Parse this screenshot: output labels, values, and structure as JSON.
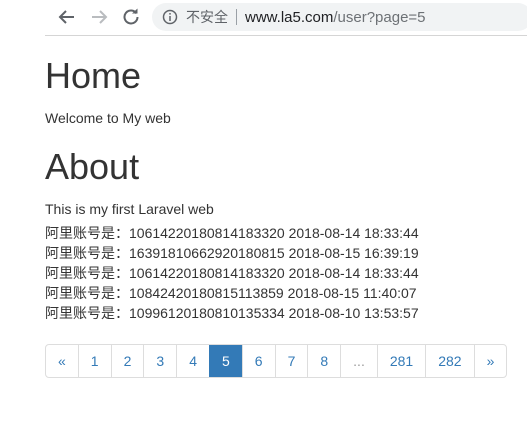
{
  "browser": {
    "security_label": "不安全",
    "url_host": "www.la5.com",
    "url_path": "/user?page=5",
    "icons": {
      "back": "back-arrow-icon",
      "forward": "forward-arrow-icon",
      "reload": "reload-icon",
      "info": "info-icon"
    }
  },
  "page": {
    "home_heading": "Home",
    "home_text": "Welcome to My web",
    "about_heading": "About",
    "about_text": "This is my first Laravel web",
    "accounts": [
      "阿里账号是：10614220180814183320 2018-08-14 18:33:44",
      "阿里账号是：16391810662920180815 2018-08-15 16:39:19",
      "阿里账号是：10614220180814183320 2018-08-14 18:33:44",
      "阿里账号是：10842420180815113859 2018-08-15 11:40:07",
      "阿里账号是：10996120180810135334 2018-08-10 13:53:57"
    ]
  },
  "pagination": {
    "prev": "«",
    "pages": [
      "1",
      "2",
      "3",
      "4",
      "5",
      "6",
      "7",
      "8"
    ],
    "ellipsis": "...",
    "last_pages": [
      "281",
      "282"
    ],
    "next": "»",
    "active_page": "5"
  },
  "colors": {
    "link": "#337ab7",
    "active_bg": "#337ab7",
    "text": "#333333",
    "omnibox_bg": "#f1f3f4"
  }
}
